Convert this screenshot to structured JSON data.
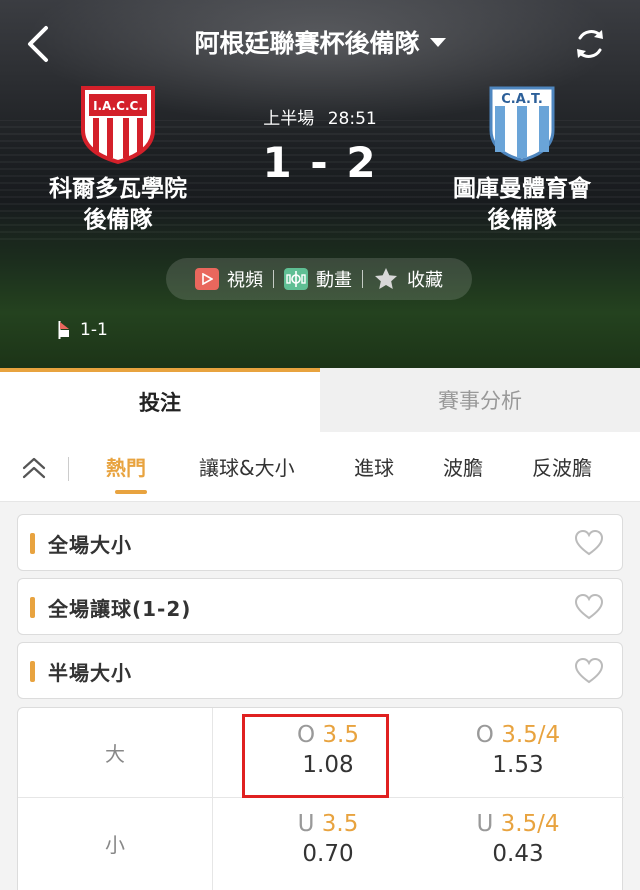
{
  "header": {
    "league_title": "阿根廷聯賽杯後備隊",
    "period": "上半場",
    "clock": "28:51",
    "score": "1 - 2",
    "home": {
      "name_line1": "科爾多瓦學院",
      "name_line2": "後備隊",
      "crest_text": "I.A.C.C.",
      "crest_color": "#d4202a"
    },
    "away": {
      "name_line1": "圖庫曼體育會",
      "name_line2": "後備隊",
      "crest_text": "C.A.T.",
      "crest_color": "#6aa4d8"
    },
    "media": {
      "video": "視頻",
      "animation": "動畫",
      "favorite": "收藏"
    },
    "corners": "1-1"
  },
  "main_tabs": {
    "bet": "投注",
    "analysis": "賽事分析"
  },
  "sub_tabs": {
    "hot": "熱門",
    "handicap_ou": "讓球&大小",
    "goals": "進球",
    "correct_score": "波膽",
    "anti_score": "反波膽"
  },
  "markets": [
    {
      "name": "全場大小"
    },
    {
      "name": "全場讓球(1-2)"
    },
    {
      "name": "半場大小"
    }
  ],
  "odds": {
    "over_label": "大",
    "under_label": "小",
    "over": [
      {
        "prefix": "O",
        "line": "3.5",
        "price": "1.08"
      },
      {
        "prefix": "O",
        "line": "3.5/4",
        "price": "1.53"
      }
    ],
    "under": [
      {
        "prefix": "U",
        "line": "3.5",
        "price": "0.70"
      },
      {
        "prefix": "U",
        "line": "3.5/4",
        "price": "0.43"
      }
    ]
  },
  "colors": {
    "accent": "#e8a33f",
    "highlight": "#e02020"
  }
}
